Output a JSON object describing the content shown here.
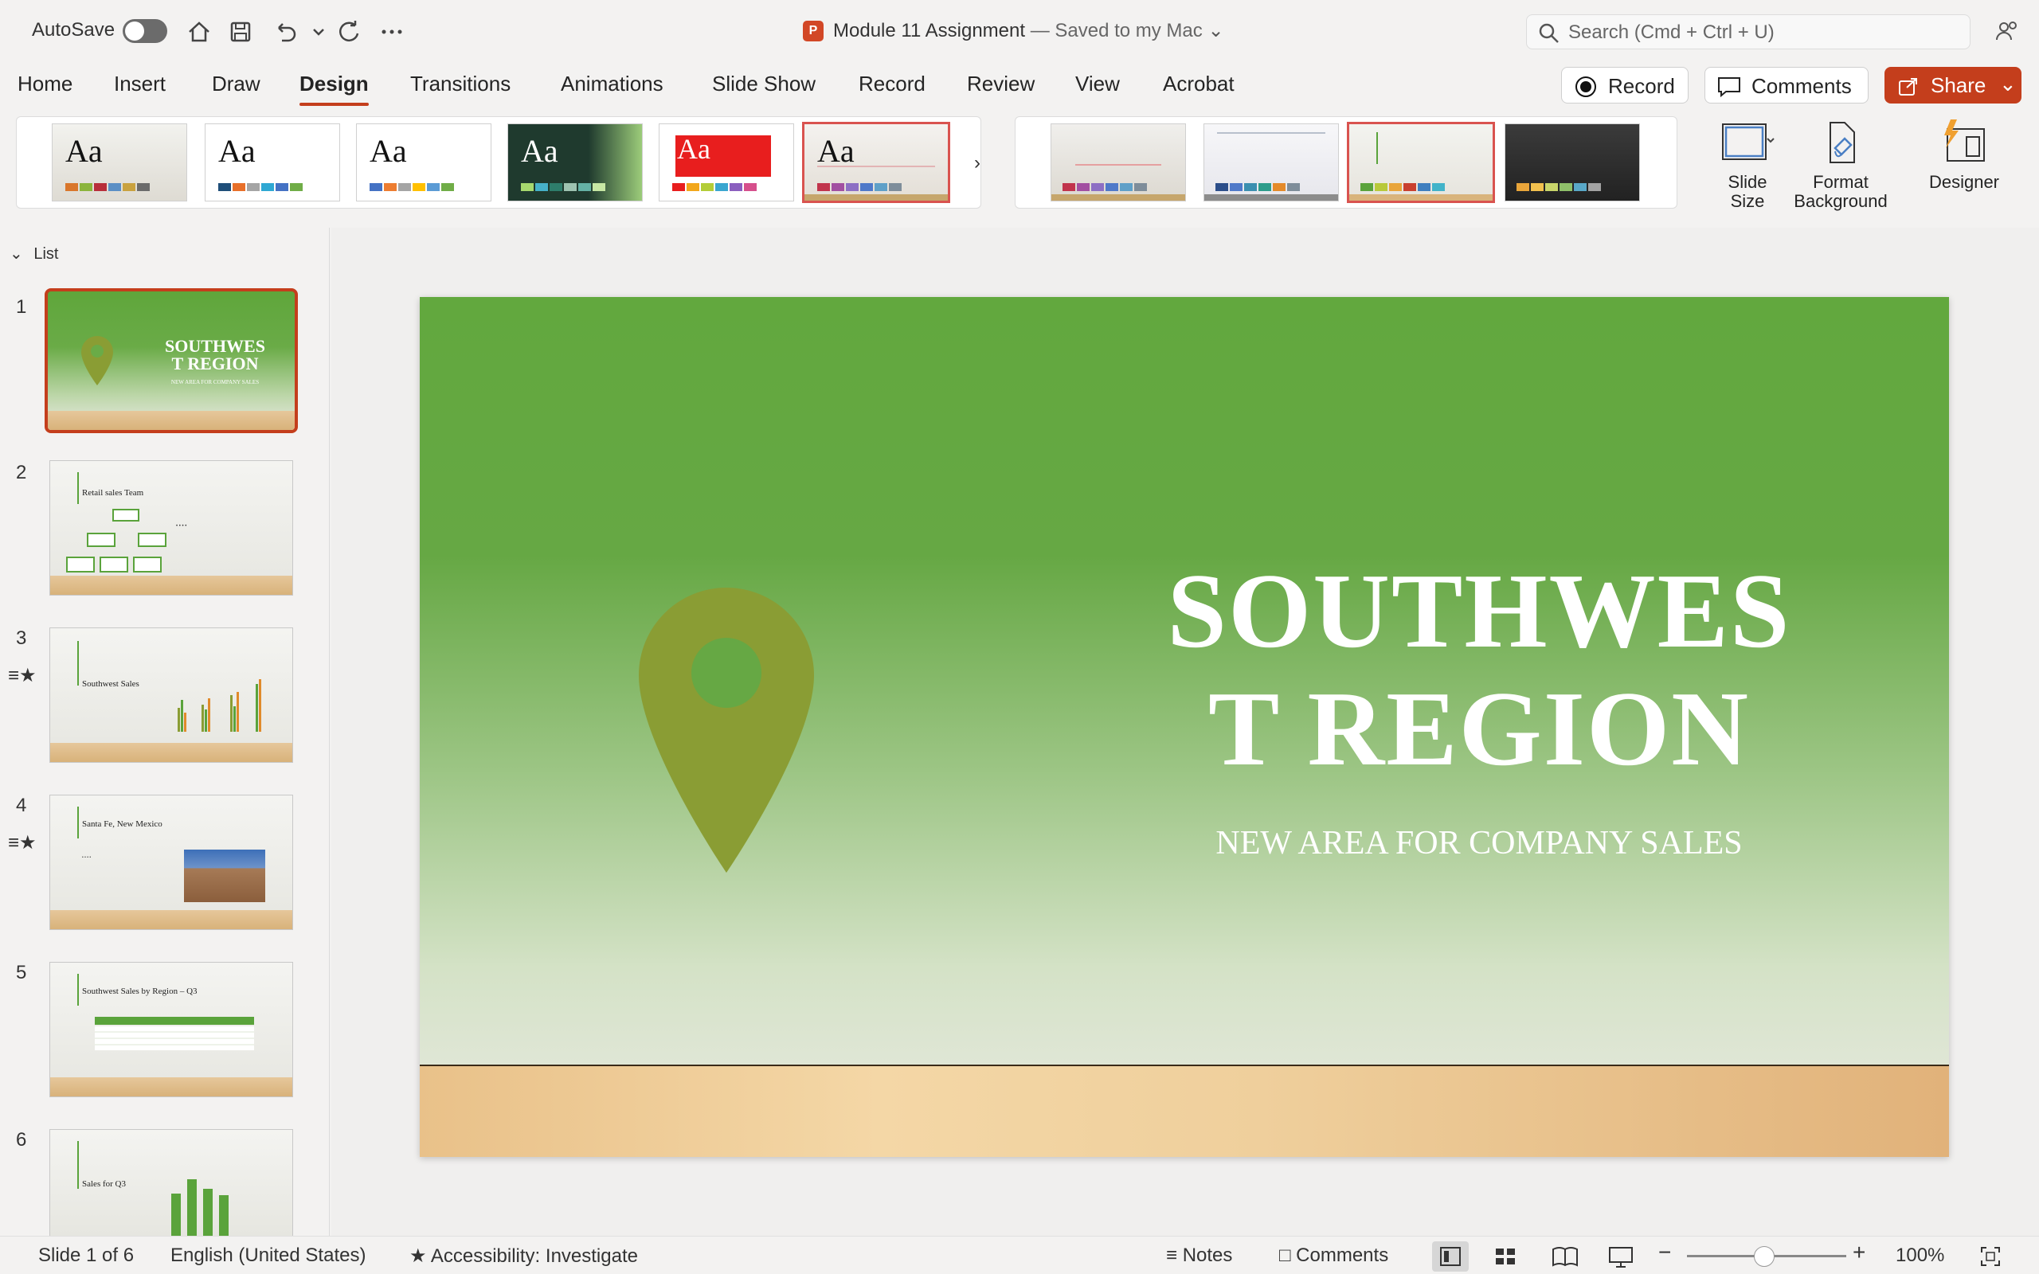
{
  "titlebar": {
    "autosave_label": "AutoSave",
    "doc_name": "Module 11 Assignment",
    "saved_status": "— Saved to my Mac",
    "search_placeholder": "Search (Cmd + Ctrl + U)"
  },
  "tabs": [
    "Home",
    "Insert",
    "Draw",
    "Design",
    "Transitions",
    "Animations",
    "Slide Show",
    "Record",
    "Review",
    "View",
    "Acrobat"
  ],
  "active_tab": "Design",
  "actions": {
    "record": "Record",
    "comments": "Comments",
    "share": "Share"
  },
  "ribbon": {
    "theme_label": "Aa",
    "slide_size": "Slide\nSize",
    "slide_size_l1": "Slide",
    "slide_size_l2": "Size",
    "format_bg_l1": "Format",
    "format_bg_l2": "Background",
    "designer": "Designer"
  },
  "pane": {
    "header": "List",
    "slides": [
      {
        "num": "1",
        "title": "SOUTHWEST REGION",
        "subtitle": "NEW AREA FOR COMPANY SALES",
        "star": false
      },
      {
        "num": "2",
        "title": "Retail sales Team",
        "star": false
      },
      {
        "num": "3",
        "title": "Southwest Sales",
        "star": true
      },
      {
        "num": "4",
        "title": "Santa Fe, New Mexico",
        "star": true
      },
      {
        "num": "5",
        "title": "Southwest Sales by Region – Q3",
        "star": false
      },
      {
        "num": "6",
        "title": "Sales for Q3",
        "star": false
      }
    ]
  },
  "slide": {
    "title_line1": "SOUTHWES",
    "title_line2": "T REGION",
    "subtitle": "NEW AREA FOR COMPANY SALES"
  },
  "thumb1": {
    "title_line1": "SOUTHWES",
    "title_line2": "T REGION",
    "subtitle": "NEW AREA FOR COMPANY SALES"
  },
  "status": {
    "slide_count": "Slide 1 of 6",
    "language": "English (United States)",
    "accessibility": "Accessibility: Investigate",
    "notes": "Notes",
    "comments": "Comments",
    "zoom": "100%"
  },
  "colors": {
    "accent": "#c43e1c",
    "slide_green": "#62a83e",
    "pin": "#8a9d34"
  },
  "icons": [
    "home-icon",
    "save-icon",
    "undo-icon",
    "redo-icon",
    "more-icon",
    "search-icon",
    "record-dot-icon",
    "comment-icon",
    "share-icon",
    "slide-size-icon",
    "format-background-icon",
    "designer-icon",
    "location-pin-icon"
  ]
}
